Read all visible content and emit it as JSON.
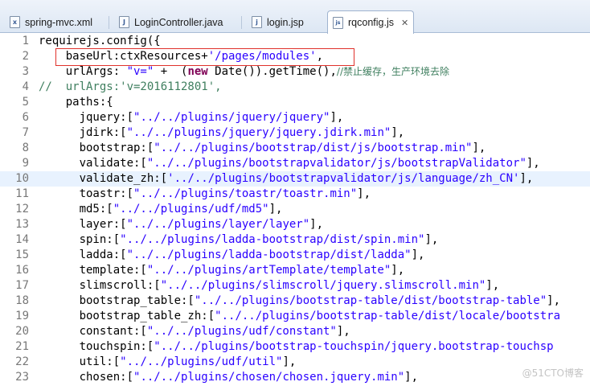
{
  "tabs": [
    {
      "label": "spring-mvc.xml",
      "icon": "xml-file-icon",
      "glyph": "x"
    },
    {
      "label": "LoginController.java",
      "icon": "java-file-icon",
      "glyph": "J"
    },
    {
      "label": "login.jsp",
      "icon": "jsp-file-icon",
      "glyph": "j"
    },
    {
      "label": "rqconfig.js",
      "icon": "js-file-icon",
      "glyph": "js",
      "active": true,
      "close": "✕"
    }
  ],
  "editor": {
    "highlighted_line": 10,
    "boxed_line": 2,
    "lines": [
      {
        "n": "1",
        "parts": [
          {
            "t": "requirejs.config({",
            "c": ""
          }
        ]
      },
      {
        "n": "2",
        "parts": [
          {
            "t": "    baseUrl:ctxResources+",
            "c": ""
          },
          {
            "t": "'/pages/modules'",
            "c": "s"
          },
          {
            "t": ",",
            "c": ""
          }
        ]
      },
      {
        "n": "3",
        "parts": [
          {
            "t": "    urlArgs: ",
            "c": ""
          },
          {
            "t": "\"v=\"",
            "c": "s"
          },
          {
            "t": " +  (",
            "c": ""
          },
          {
            "t": "new",
            "c": "k"
          },
          {
            "t": " Date()).getTime(),",
            "c": ""
          },
          {
            "t": "//禁止缓存，生产环境去除",
            "c": "c cjk"
          }
        ]
      },
      {
        "n": "4",
        "parts": [
          {
            "t": "//  urlArgs:'v=2016112801',",
            "c": "c"
          }
        ]
      },
      {
        "n": "5",
        "parts": [
          {
            "t": "    paths:{",
            "c": ""
          }
        ]
      },
      {
        "n": "6",
        "parts": [
          {
            "t": "      jquery:[",
            "c": ""
          },
          {
            "t": "\"../../plugins/jquery/jquery\"",
            "c": "s"
          },
          {
            "t": "],",
            "c": ""
          }
        ]
      },
      {
        "n": "7",
        "parts": [
          {
            "t": "      jdirk:[",
            "c": ""
          },
          {
            "t": "\"../../plugins/jquery/jquery.jdirk.min\"",
            "c": "s"
          },
          {
            "t": "],",
            "c": ""
          }
        ]
      },
      {
        "n": "8",
        "parts": [
          {
            "t": "      bootstrap:[",
            "c": ""
          },
          {
            "t": "\"../../plugins/bootstrap/dist/js/bootstrap.min\"",
            "c": "s"
          },
          {
            "t": "],",
            "c": ""
          }
        ]
      },
      {
        "n": "9",
        "parts": [
          {
            "t": "      validate:[",
            "c": ""
          },
          {
            "t": "\"../../plugins/bootstrapvalidator/js/bootstrapValidator\"",
            "c": "s"
          },
          {
            "t": "],",
            "c": ""
          }
        ]
      },
      {
        "n": "10",
        "parts": [
          {
            "t": "      validate_zh:[",
            "c": ""
          },
          {
            "t": "'../../plugins/bootstrapvalidator/js/language/zh_CN'",
            "c": "s"
          },
          {
            "t": "],",
            "c": ""
          }
        ]
      },
      {
        "n": "11",
        "parts": [
          {
            "t": "      toastr:[",
            "c": ""
          },
          {
            "t": "\"../../plugins/toastr/toastr.min\"",
            "c": "s"
          },
          {
            "t": "],",
            "c": ""
          }
        ]
      },
      {
        "n": "12",
        "parts": [
          {
            "t": "      md5:[",
            "c": ""
          },
          {
            "t": "\"../../plugins/udf/md5\"",
            "c": "s"
          },
          {
            "t": "],",
            "c": ""
          }
        ]
      },
      {
        "n": "13",
        "parts": [
          {
            "t": "      layer:[",
            "c": ""
          },
          {
            "t": "\"../../plugins/layer/layer\"",
            "c": "s"
          },
          {
            "t": "],",
            "c": ""
          }
        ]
      },
      {
        "n": "14",
        "parts": [
          {
            "t": "      spin:[",
            "c": ""
          },
          {
            "t": "\"../../plugins/ladda-bootstrap/dist/spin.min\"",
            "c": "s"
          },
          {
            "t": "],",
            "c": ""
          }
        ]
      },
      {
        "n": "15",
        "parts": [
          {
            "t": "      ladda:[",
            "c": ""
          },
          {
            "t": "\"../../plugins/ladda-bootstrap/dist/ladda\"",
            "c": "s"
          },
          {
            "t": "],",
            "c": ""
          }
        ]
      },
      {
        "n": "16",
        "parts": [
          {
            "t": "      template:[",
            "c": ""
          },
          {
            "t": "\"../../plugins/artTemplate/template\"",
            "c": "s"
          },
          {
            "t": "],",
            "c": ""
          }
        ]
      },
      {
        "n": "17",
        "parts": [
          {
            "t": "      slimscroll:[",
            "c": ""
          },
          {
            "t": "\"../../plugins/slimscroll/jquery.slimscroll.min\"",
            "c": "s"
          },
          {
            "t": "],",
            "c": ""
          }
        ]
      },
      {
        "n": "18",
        "parts": [
          {
            "t": "      bootstrap_table:[",
            "c": ""
          },
          {
            "t": "\"../../plugins/bootstrap-table/dist/bootstrap-table\"",
            "c": "s"
          },
          {
            "t": "],",
            "c": ""
          }
        ]
      },
      {
        "n": "19",
        "parts": [
          {
            "t": "      bootstrap_table_zh:[",
            "c": ""
          },
          {
            "t": "\"../../plugins/bootstrap-table/dist/locale/bootstra",
            "c": "s"
          }
        ]
      },
      {
        "n": "20",
        "parts": [
          {
            "t": "      constant:[",
            "c": ""
          },
          {
            "t": "\"../../plugins/udf/constant\"",
            "c": "s"
          },
          {
            "t": "],",
            "c": ""
          }
        ]
      },
      {
        "n": "21",
        "parts": [
          {
            "t": "      touchspin:[",
            "c": ""
          },
          {
            "t": "\"../../plugins/bootstrap-touchspin/jquery.bootstrap-touchsp",
            "c": "s"
          }
        ]
      },
      {
        "n": "22",
        "parts": [
          {
            "t": "      util:[",
            "c": ""
          },
          {
            "t": "\"../../plugins/udf/util\"",
            "c": "s"
          },
          {
            "t": "],",
            "c": ""
          }
        ]
      },
      {
        "n": "23",
        "parts": [
          {
            "t": "      chosen:[",
            "c": ""
          },
          {
            "t": "\"../../plugins/chosen/chosen.jquery.min\"",
            "c": "s"
          },
          {
            "t": "],",
            "c": ""
          }
        ]
      }
    ]
  },
  "watermark": "@51CTO博客",
  "colors": {
    "string": "#2a00ff",
    "keyword": "#7f0055",
    "comment": "#3f7f5f",
    "highlight": "#e8f2fe",
    "box": "#e0312b"
  }
}
